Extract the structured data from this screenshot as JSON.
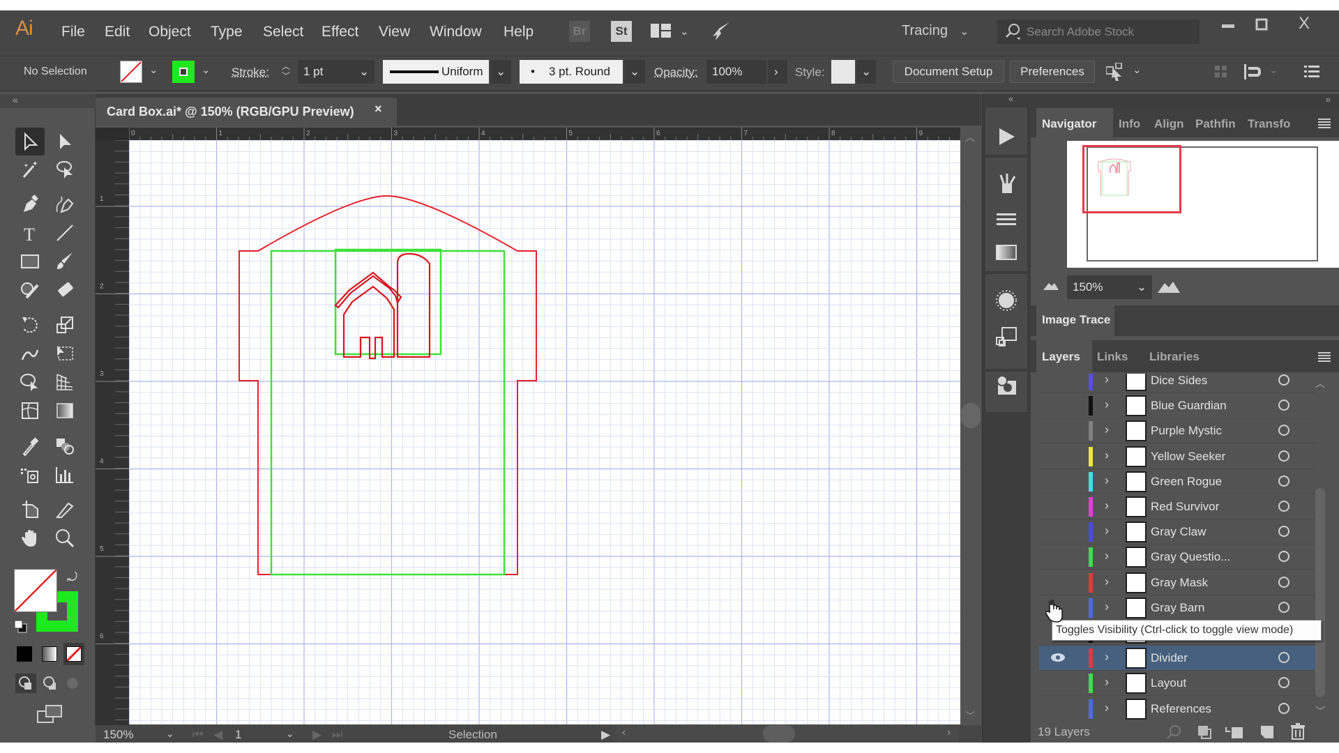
{
  "app": {
    "logo": "Ai",
    "menu": [
      "File",
      "Edit",
      "Object",
      "Type",
      "Select",
      "Effect",
      "View",
      "Window",
      "Help"
    ],
    "bridge_label": "Br",
    "stock_label": "St",
    "workspace": "Tracing",
    "search_placeholder": "Search Adobe Stock",
    "window_controls": {
      "minimize": "—",
      "maximize": "☐",
      "close": "X"
    }
  },
  "control_bar": {
    "selection_label": "No Selection",
    "fill": "none",
    "stroke_color": "#00ff00",
    "stroke_label": "Stroke:",
    "stroke_weight": "1 pt",
    "profile_label": "Uniform",
    "brush_label": "3 pt. Round",
    "opacity_label": "Opacity:",
    "opacity_value": "100%",
    "style_label": "Style:",
    "document_setup": "Document Setup",
    "preferences": "Preferences"
  },
  "document": {
    "tab_title": "Card Box.ai* @ 150% (RGB/GPU Preview)",
    "close_label": "×",
    "ruler_top_labels": [
      "0",
      "1",
      "2",
      "3",
      "4",
      "5",
      "6",
      "7",
      "8",
      "9"
    ],
    "ruler_left_labels": [
      "1",
      "2",
      "3",
      "4",
      "5",
      "6"
    ],
    "artwork_colors": {
      "cut": "#e8202a",
      "layout": "#3de23a",
      "grid_major": "#a9b3ec",
      "grid_minor": "#d5dbf4"
    }
  },
  "status_bar": {
    "zoom": "150%",
    "artboard": "1",
    "tool": "Selection"
  },
  "tools": {
    "fill_swatch": "none",
    "stroke_swatch": "#00ff00"
  },
  "navigator": {
    "tabs": [
      "Navigator",
      "Info",
      "Align",
      "Pathfin",
      "Transfo"
    ],
    "active_tab": "Navigator",
    "zoom": "150%"
  },
  "image_trace": {
    "tab": "Image Trace"
  },
  "layers_panel": {
    "tabs": [
      "Layers",
      "Links",
      "Libraries"
    ],
    "active_tab": "Layers",
    "count_label": "19 Layers",
    "tooltip": "Toggles Visibility (Ctrl-click to toggle view mode)",
    "layers": [
      {
        "name": "Dice Sides",
        "color": "#5a4cf0",
        "visible": false,
        "partial": true
      },
      {
        "name": "Blue Guardian",
        "color": "#111111",
        "visible": false
      },
      {
        "name": "Purple Mystic",
        "color": "#808080",
        "visible": false
      },
      {
        "name": "Yellow Seeker",
        "color": "#e8e83a",
        "visible": false
      },
      {
        "name": "Green Rogue",
        "color": "#3ae0e8",
        "visible": false
      },
      {
        "name": "Red Survivor",
        "color": "#e83ae0",
        "visible": false
      },
      {
        "name": "Gray Claw",
        "color": "#4a4ae8",
        "visible": false
      },
      {
        "name": "Gray Questio...",
        "color": "#3ae04a",
        "visible": false
      },
      {
        "name": "Gray Mask",
        "color": "#e03a3a",
        "visible": false
      },
      {
        "name": "Gray Barn",
        "color": "#4a6ae8",
        "visible": false
      },
      {
        "name": "",
        "color": "#111111",
        "visible": false,
        "hidden_by_tooltip": true
      },
      {
        "name": "Divider",
        "color": "#e03a3a",
        "visible": true,
        "selected": true
      },
      {
        "name": "Layout",
        "color": "#3ae04a",
        "visible": false
      },
      {
        "name": "References",
        "color": "#4a6ae8",
        "visible": false
      }
    ]
  }
}
